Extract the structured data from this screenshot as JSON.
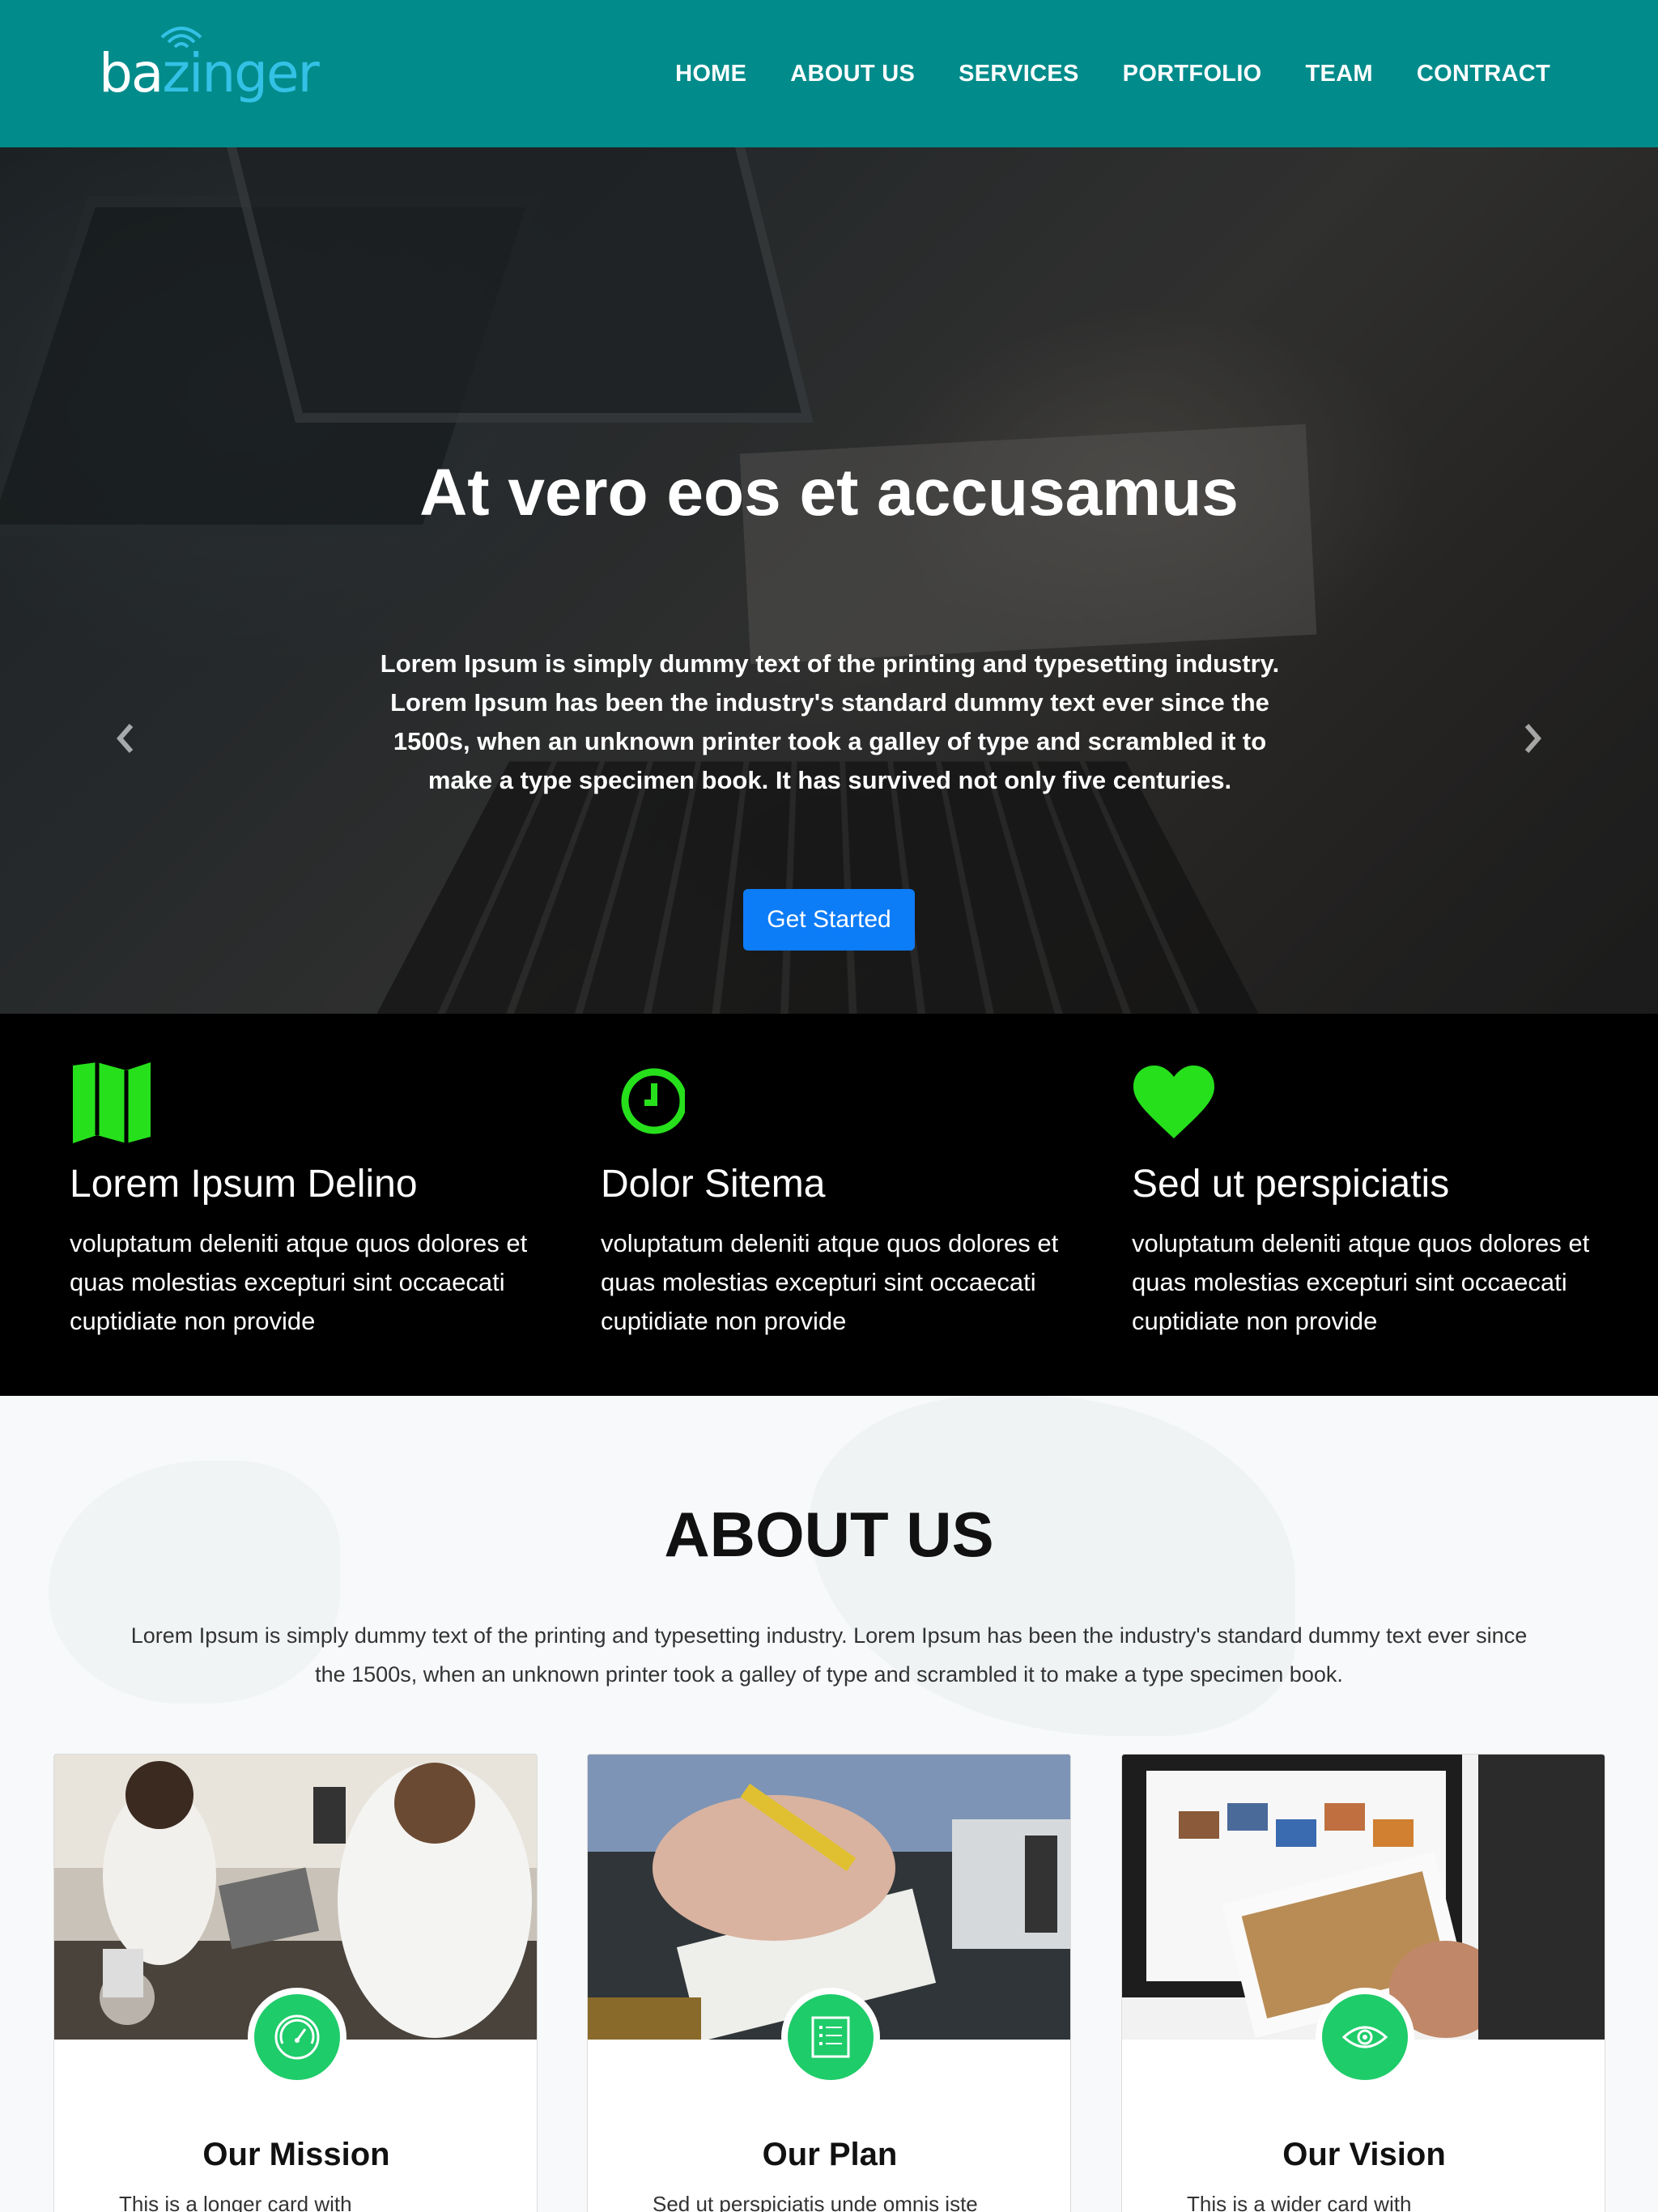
{
  "brand": {
    "logo_ba": "ba",
    "logo_rest": "zinger"
  },
  "nav": {
    "items": [
      {
        "label": "HOME"
      },
      {
        "label": "ABOUT US"
      },
      {
        "label": "SERVICES"
      },
      {
        "label": "PORTFOLIO"
      },
      {
        "label": "TEAM"
      },
      {
        "label": "CONTRACT"
      }
    ]
  },
  "hero": {
    "title": "At vero eos et accusamus",
    "text": "Lorem Ipsum is simply dummy text of the printing and typesetting industry. Lorem Ipsum has been the industry's standard dummy text ever since the 1500s, when an unknown printer took a galley of type and scrambled it to make a type specimen book. It has survived not only five centuries.",
    "button": "Get Started",
    "slides_count": 5,
    "active_slide": 2
  },
  "features": [
    {
      "icon": "map-icon",
      "title": "Lorem Ipsum Delino",
      "text": "voluptatum deleniti atque quos dolores et quas molestias excepturi sint occaecati cuptidiate non provide"
    },
    {
      "icon": "clock-icon",
      "title": "Dolor Sitema",
      "text": "voluptatum deleniti atque quos dolores et quas molestias excepturi sint occaecati cuptidiate non provide"
    },
    {
      "icon": "heart-icon",
      "title": "Sed ut perspiciatis",
      "text": "voluptatum deleniti atque quos dolores et quas molestias excepturi sint occaecati cuptidiate non provide"
    }
  ],
  "about": {
    "title": "ABOUT US",
    "text": "Lorem Ipsum is simply dummy text of the printing and typesetting industry. Lorem Ipsum has been the industry's standard dummy text ever since the 1500s, when an unknown printer took a galley of type and scrambled it to make a type specimen book.",
    "cards": [
      {
        "icon": "speedometer-icon",
        "title": "Our Mission",
        "text": "This is a longer card with"
      },
      {
        "icon": "list-icon",
        "title": "Our Plan",
        "text": "Sed ut perspiciatis unde omnis iste"
      },
      {
        "icon": "eye-icon",
        "title": "Our Vision",
        "text": "This is a wider card with"
      }
    ]
  },
  "colors": {
    "navbar": "#028b8b",
    "accent_green": "#1fcc6a",
    "feature_icon": "#26e01c",
    "button_blue": "#0d7cf7",
    "features_bg": "#000000"
  }
}
